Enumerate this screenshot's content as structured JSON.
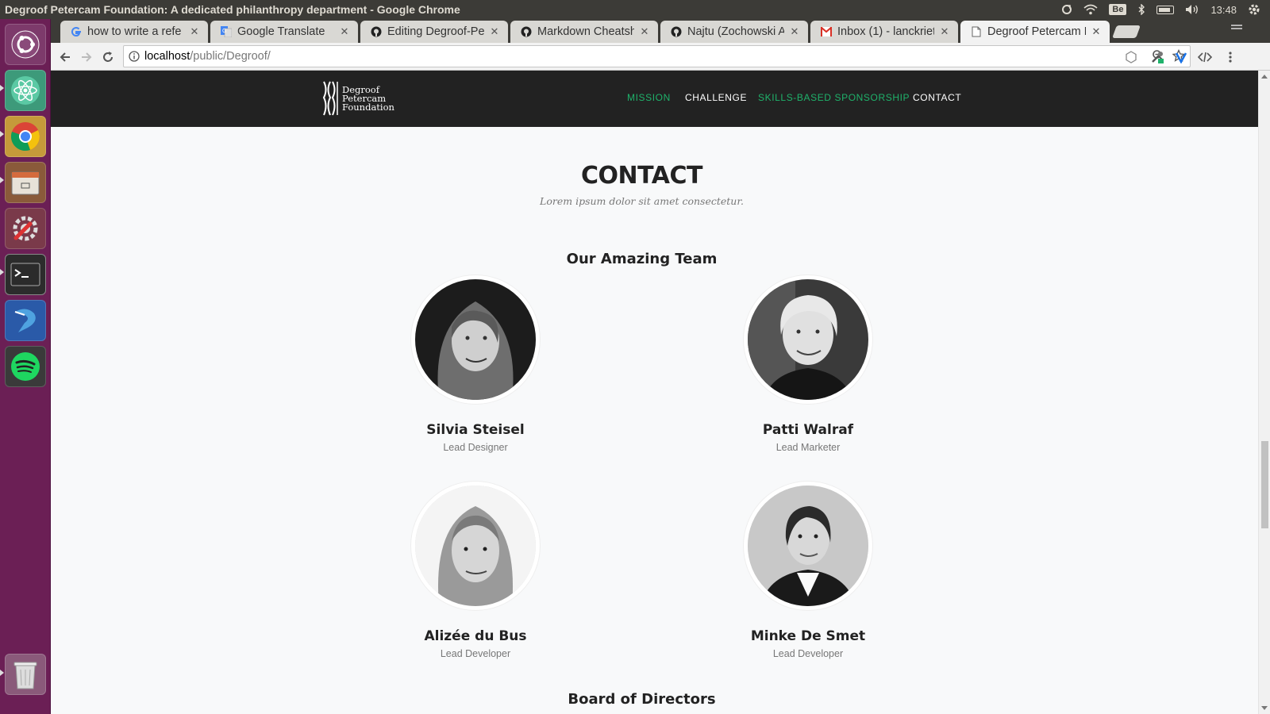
{
  "os": {
    "window_title": "Degroof Petercam Foundation: A dedicated philanthropy department - Google Chrome",
    "clock": "13:48",
    "keyboard_layout": "Be"
  },
  "launcher": {
    "items": [
      "ubuntu-dash-icon",
      "atom-editor-icon",
      "chrome-icon",
      "files-icon",
      "system-settings-icon",
      "terminal-icon",
      "dart-editor-icon",
      "spotify-icon",
      "trash-icon"
    ]
  },
  "browser": {
    "tabs": [
      {
        "title": "how to write a refe",
        "favicon": "google-icon"
      },
      {
        "title": "Google Translate",
        "favicon": "translate-icon"
      },
      {
        "title": "Editing Degroof-Pe",
        "favicon": "github-icon"
      },
      {
        "title": "Markdown Cheatsh",
        "favicon": "github-icon"
      },
      {
        "title": "Najtu (Zochowski A",
        "favicon": "github-icon"
      },
      {
        "title": "Inbox (1) - lanckriet",
        "favicon": "gmail-icon"
      },
      {
        "title": "Degroof Petercam F",
        "favicon": "page-icon"
      }
    ],
    "url_host": "localhost",
    "url_path": "/public/Degroof/"
  },
  "site": {
    "logo_lines": [
      "Degroof",
      "Petercam",
      "Foundation"
    ],
    "nav": [
      {
        "label": "MISSION",
        "color": "#1fb26b"
      },
      {
        "label": "CHALLENGE",
        "color": "#ffffff"
      },
      {
        "label": "SKILLS-BASED SPONSORSHIP",
        "color": "#1fb26b"
      },
      {
        "label": "CONTACT",
        "color": "#ffffff"
      }
    ],
    "contact": {
      "title": "CONTACT",
      "subtitle": "Lorem ipsum dolor sit amet consectetur.",
      "team_heading": "Our Amazing Team",
      "members": [
        {
          "name": "Silvia Steisel",
          "role": "Lead Designer"
        },
        {
          "name": "Patti Walraf",
          "role": "Lead Marketer"
        },
        {
          "name": "Alizée du Bus",
          "role": "Lead Developer"
        },
        {
          "name": "Minke De Smet",
          "role": "Lead Developer"
        }
      ],
      "next_heading_partial": "Board of Directors"
    }
  }
}
